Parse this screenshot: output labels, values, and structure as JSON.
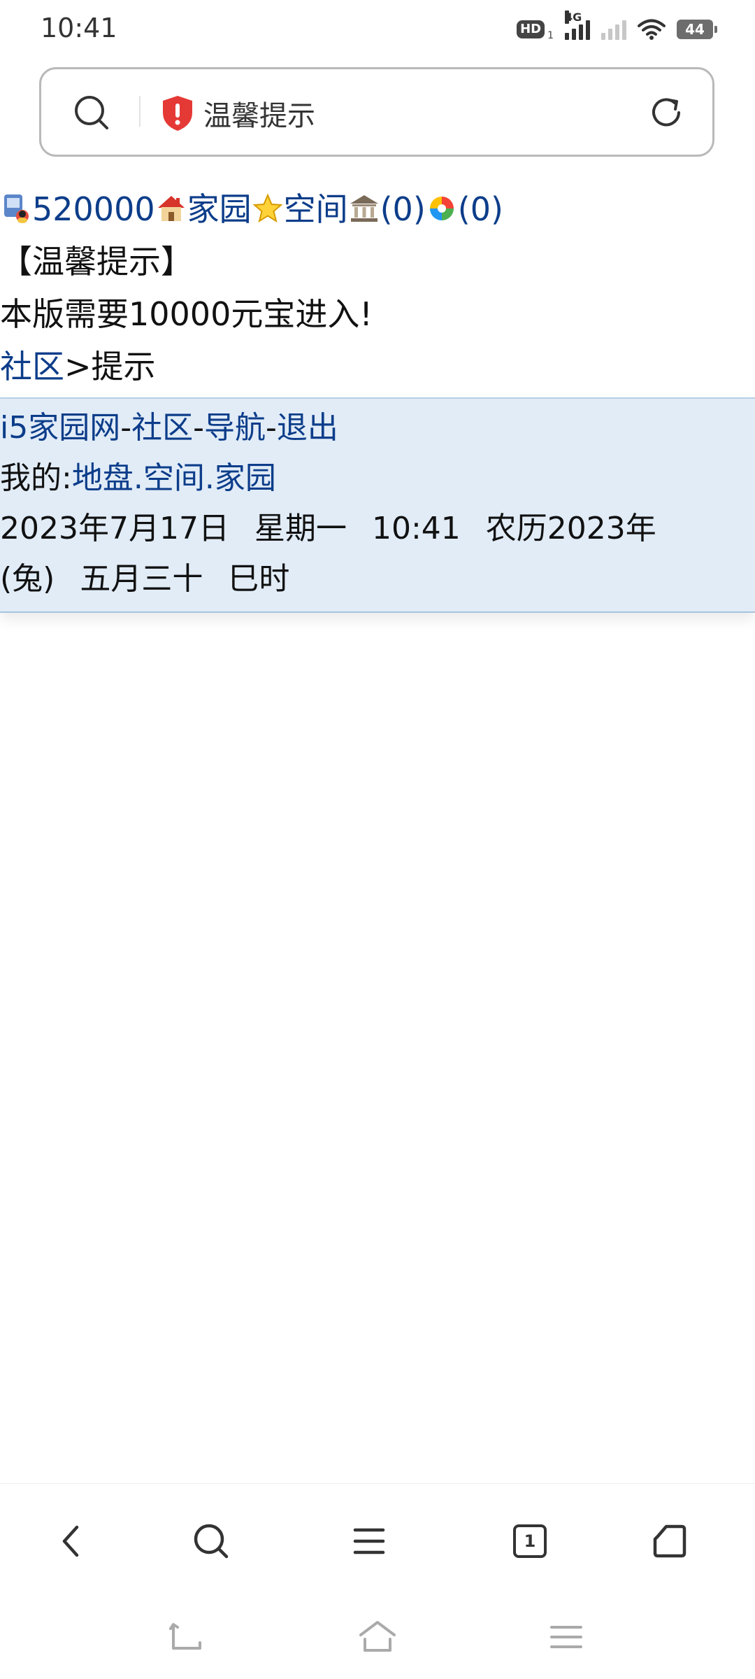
{
  "status_bar": {
    "time": "10:41",
    "hd_badge": "HD",
    "hd_sub": "1",
    "network": "4G",
    "battery": "44",
    "icons": [
      "hd-icon",
      "signal-4g-icon",
      "signal-icon",
      "wifi-icon",
      "battery-icon"
    ]
  },
  "address_bar": {
    "title": "温馨提示",
    "icons": [
      "search-icon",
      "shield-warning-icon",
      "reload-icon"
    ],
    "shield_color": "#e53935"
  },
  "top_links": {
    "qq_number": "520000",
    "home_link": "家园",
    "space_link": "空间",
    "bank_count": "(0)",
    "album_count": "(0)"
  },
  "content": {
    "heading": "【温馨提示】",
    "message": "本版需要10000元宝进入!",
    "breadcrumb_link": "社区",
    "breadcrumb_sep": ">",
    "breadcrumb_current": "提示"
  },
  "footer_panel": {
    "nav_links": [
      "i5家园网",
      "社区",
      "导航",
      "退出"
    ],
    "separator": "-",
    "mine_label": "我的:",
    "mine_links": [
      "地盘",
      "空间",
      "家园"
    ],
    "mine_sep": ".",
    "date": "2023年7月17日",
    "weekday": "星期一",
    "time": "10:41",
    "lunar_prefix": "农历2023年",
    "lunar_zodiac": "(兔)",
    "lunar_day": "五月三十",
    "lunar_hour": "巳时"
  },
  "toolbar": {
    "tabs_count": "1",
    "icons": [
      "back-icon",
      "search-icon",
      "menu-icon",
      "tabs-icon",
      "home-icon"
    ]
  },
  "system_nav": {
    "icons": [
      "nav-back-icon",
      "nav-home-icon",
      "nav-recents-icon"
    ]
  },
  "colors": {
    "link": "#0d3d8a",
    "panel_bg": "#e1ecf7",
    "panel_border": "#b8cfe6"
  }
}
